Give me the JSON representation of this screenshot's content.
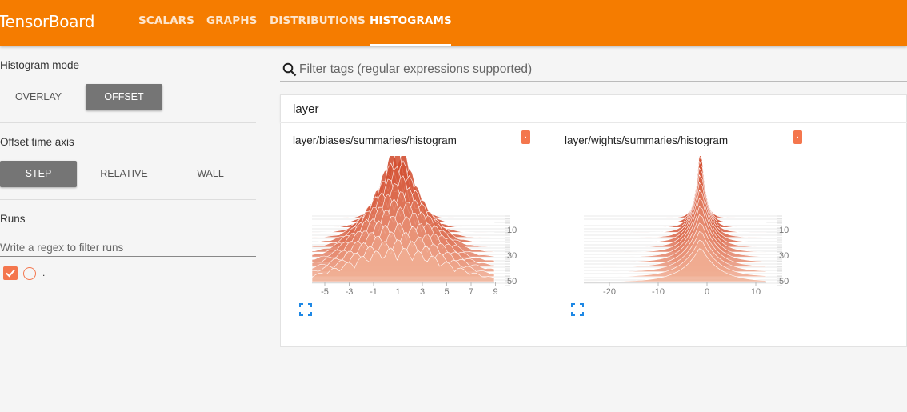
{
  "app": {
    "brand": "TensorBoard",
    "tabs": [
      {
        "label": "SCALARS",
        "active": false
      },
      {
        "label": "GRAPHS",
        "active": false
      },
      {
        "label": "DISTRIBUTIONS",
        "active": false
      },
      {
        "label": "HISTOGRAMS",
        "active": true
      }
    ],
    "accent_color": "#f57c00",
    "run_color": "#f4764d"
  },
  "sidebar": {
    "histogram_mode": {
      "title": "Histogram mode",
      "options": [
        "OVERLAY",
        "OFFSET"
      ],
      "selected": "OFFSET"
    },
    "offset_time_axis": {
      "title": "Offset time axis",
      "options": [
        "STEP",
        "RELATIVE",
        "WALL"
      ],
      "selected": "STEP"
    },
    "runs": {
      "title": "Runs",
      "filter_placeholder": "Write a regex to filter runs",
      "items": [
        {
          "name": ".",
          "checked": true
        }
      ]
    }
  },
  "main": {
    "search_placeholder": "Filter tags (regular expressions supported)",
    "group": {
      "name": "layer",
      "cards": [
        {
          "title": "layer/biases/summaries/histogram",
          "run_badge": ".",
          "x_ticks": [
            "-5",
            "-3",
            "-1",
            "1",
            "3",
            "5",
            "7",
            "9"
          ],
          "y_ticks": [
            "10",
            "30",
            "50"
          ],
          "icons": [
            "expand-icon"
          ]
        },
        {
          "title": "layer/wights/summaries/histogram",
          "run_badge": ".",
          "x_ticks": [
            "-20",
            "-10",
            "0",
            "10"
          ],
          "y_ticks": [
            "10",
            "30",
            "50"
          ],
          "icons": [
            "expand-icon"
          ]
        }
      ]
    }
  }
}
